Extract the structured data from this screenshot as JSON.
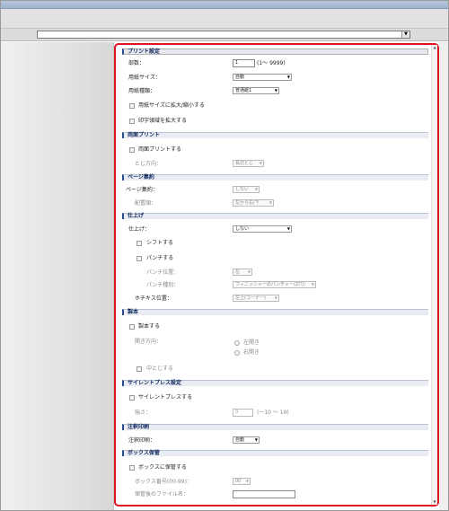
{
  "window": {
    "address_value": ""
  },
  "print_settings": {
    "header": "プリント設定",
    "copies_label": "部数：",
    "copies_value": "1",
    "copies_range": "(1〜 9999)",
    "paper_size_label": "用紙サイズ：",
    "paper_size_value": "自動",
    "paper_type_label": "用紙種類：",
    "paper_type_value": "普通紙1",
    "fit_to_paper_label": "用紙サイズに拡大/縮小する",
    "expand_print_area_label": "印字領域を拡大する"
  },
  "duplex": {
    "header": "両面プリント",
    "duplex_label": "両面プリントする",
    "binding_label": "とじ方向：",
    "binding_value": "長辺とじ"
  },
  "page_layout": {
    "header": "ページ集約",
    "pages_per_sheet_label": "ページ集約：",
    "pages_per_sheet_value": "しない",
    "order_label": "配置順：",
    "order_value": "左から右",
    "order_suffix": "/下"
  },
  "finishing": {
    "header": "仕上げ",
    "finishing_label": "仕上げ：",
    "finishing_value": "しない",
    "shift_label": "シフトする",
    "punch_label": "パンチする",
    "punch_position_label": "パンチ位置：",
    "punch_position_value": "左",
    "punch_type_label": "パンチ種別：",
    "punch_type_value": "フィニッシャーのパンチャー(2穴)",
    "staple_position_label": "ホチキス位置：",
    "staple_position_value": "左上(コーナー)"
  },
  "booklet": {
    "header": "製本",
    "booklet_label": "製本する",
    "opening_direction_label": "開き方向：",
    "left_open_label": "左開き",
    "right_open_label": "右開き",
    "saddle_stitch_label": "中とじする"
  },
  "toner_save": {
    "header": "サイレントプレス設定",
    "enable_label": "サイレントプレスする",
    "strength_label": "強さ：",
    "strength_value": "0",
    "strength_range": "(ー10 〜 10)"
  },
  "annotation": {
    "header": "注釈印刷",
    "annotation_label": "注釈印刷：",
    "annotation_value": "自動"
  },
  "box_storage": {
    "header": "ボックス保管",
    "save_to_box_label": "ボックスに保管する",
    "box_number_label": "ボックス番号(00-99)：",
    "box_number_value": "00",
    "file_name_label": "保管後のファイル名：",
    "file_name_value": ""
  }
}
